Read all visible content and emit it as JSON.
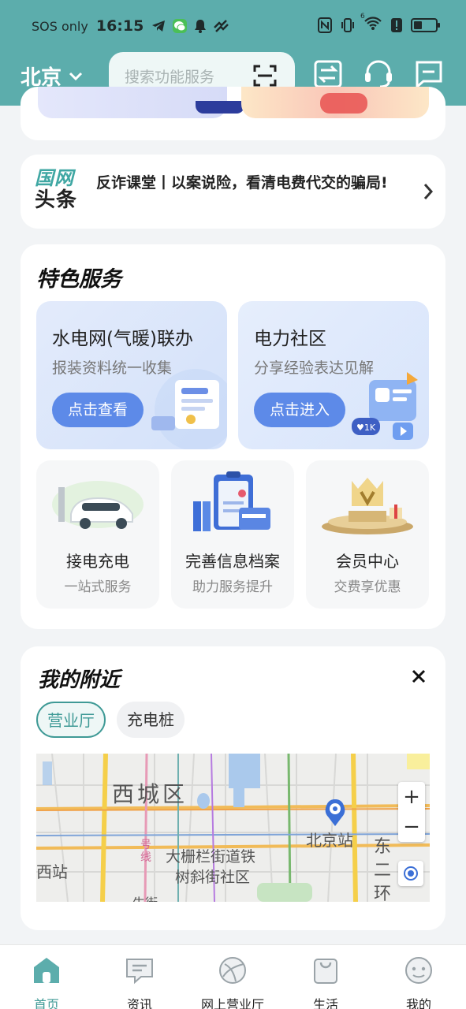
{
  "status_bar": {
    "carrier": "SOS only",
    "time": "16:15",
    "network_label": "6"
  },
  "header": {
    "city": "北京",
    "search_placeholder": "搜索功能服务"
  },
  "news": {
    "logo_top": "国网",
    "logo_bottom": "头条",
    "headline": "反诈课堂丨以案说险，看清电费代交的骗局!"
  },
  "services": {
    "title": "特色服务",
    "big": [
      {
        "title": "水电网(气暖)联办",
        "subtitle": "报装资料统一收集",
        "button": "点击查看"
      },
      {
        "title": "电力社区",
        "subtitle": "分享经验表达见解",
        "button": "点击进入"
      }
    ],
    "small": [
      {
        "title": "接电充电",
        "subtitle": "一站式服务"
      },
      {
        "title": "完善信息档案",
        "subtitle": "助力服务提升"
      },
      {
        "title": "会员中心",
        "subtitle": "交费享优惠"
      }
    ]
  },
  "nearby": {
    "title": "我的附近",
    "chips": [
      "营业厅",
      "充电桩"
    ],
    "active_chip": "营业厅",
    "map_labels": {
      "district": "西城区",
      "station": "北京站",
      "community_1": "大栅栏街道铁",
      "community_2": "树斜街社区",
      "ring_road": "东二环",
      "west_station": "西站",
      "road": "号线",
      "street": "牛街"
    }
  },
  "tabbar": {
    "items": [
      "首页",
      "资讯",
      "网上营业厅",
      "生活",
      "我的"
    ],
    "active": "首页"
  },
  "colors": {
    "brand": "#5cadac",
    "accent": "#3f9a96",
    "button_blue": "#5d8ae8"
  }
}
